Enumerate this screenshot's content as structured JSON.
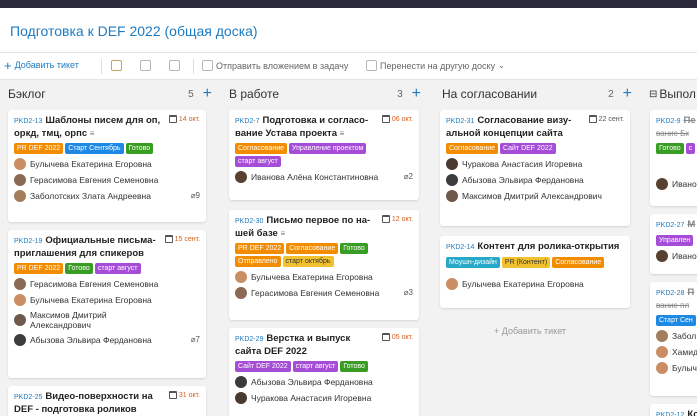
{
  "board": {
    "title": "Подготовка к DEF 2022 (общая доска)"
  },
  "toolbar": {
    "add_label": "Добавить тикет",
    "send_label": "Отправить вложением в задачу",
    "move_label": "Перенести на другую доску"
  },
  "columns": [
    {
      "title": "Бэклог",
      "count": "5",
      "plus": "+"
    },
    {
      "title": "В работе",
      "count": "3",
      "plus": "+"
    },
    {
      "title": "На согласовании",
      "count": "2",
      "plus": "+"
    },
    {
      "title": "Выпол",
      "count": "",
      "plus": ""
    }
  ],
  "colors": {
    "accent": "#1e7bc2",
    "tag_orange": "#f28c00",
    "tag_blue": "#1e88e5",
    "tag_green": "#3a9d23",
    "tag_purple": "#a64dd8",
    "tag_cyan": "#26a9c9",
    "tag_yellow": "#f2c12e"
  },
  "cards": {
    "c1": {
      "id": "PKD2-13",
      "title": "Шаблоны писем для оп, оркд, тмц, орпс",
      "date": "14 окт.",
      "tags": [
        "PR DEF 2022",
        "Старт Сентябрь",
        "Готово"
      ],
      "people": [
        "Булычева Екатерина Егоровна",
        "Герасимова Евгения Семеновна",
        "Заболотских Злата Андреевна"
      ],
      "attach": "9"
    },
    "c2": {
      "id": "PKD2-19",
      "title": "Официальные письма-приглашения для спикеров",
      "date": "15 сент.",
      "tags": [
        "PR DEF 2022",
        "Готово",
        "старт август"
      ],
      "people": [
        "Герасимова Евгения Семеновна",
        "Булычева Екатерина Егоровна",
        "Максимов Дмитрий Александрович",
        "Абызова Эльвира Ферда­новна"
      ],
      "attach": "7"
    },
    "c3": {
      "id": "PKD2-25",
      "title": "Видео-поверхности на DEF - подготовка роликов",
      "date": "31 окт."
    },
    "c4": {
      "id": "PKD2-7",
      "title": "Подготовка и согласо­вание Устава проекта",
      "date": "06 окт.",
      "tags": [
        "Согласование",
        "Управление проектом",
        "старт август"
      ],
      "people": [
        "Иванова Алёна Константиновна"
      ],
      "attach": "2"
    },
    "c5": {
      "id": "PKD2-30",
      "title": "Письмо первое по на­шей базе",
      "date": "12 окт.",
      "tags": [
        "PR DEF 2022",
        "Согласование",
        "Готово",
        "Отправлено",
        "старт октябрь"
      ],
      "people": [
        "Булычева Екатерина Егоровна",
        "Герасимова Евгения Семеновна"
      ],
      "attach": "3"
    },
    "c6": {
      "id": "PKD2-29",
      "title": "Верстка и выпуск сайта DEF 2022",
      "date": "05 окт.",
      "tags": [
        "Сайт DEF 2022",
        "старт август",
        "Готово"
      ],
      "people": [
        "Абызова Эльвира Ферда­новна",
        "Чуракова Анастасия Игоревна"
      ]
    },
    "c7": {
      "id": "PKD2-31",
      "title": "Согласование визу­альной концепции сайта",
      "date": "22 сент.",
      "tags": [
        "Согласование",
        "Сайт DEF 2022"
      ],
      "people": [
        "Чуракова Анастасия Игоревна",
        "Абызова Эльвира Ферда­новна",
        "Максимов Дмитрий Александрович"
      ]
    },
    "c8": {
      "id": "PKD2-14",
      "title": "Контент для ролика-открытия",
      "tags": [
        "Моушн-дизайн",
        "PR (Контент)",
        "Согласование"
      ],
      "people": [
        "Булычева Екатерина Егоровна"
      ]
    },
    "add_ticket": "+ Добавить тикет",
    "d1": {
      "id": "PKD2-9",
      "title": "Пе",
      "title2": "вание Бк",
      "tags": [
        "Готово",
        "с"
      ],
      "person": "Ивано"
    },
    "d2": {
      "id": "PKD2-27",
      "title": "М",
      "tags": [
        "Управлен"
      ],
      "person": "Ивано"
    },
    "d3": {
      "id": "PKD2-28",
      "title": "П",
      "title2": "вание пл",
      "tags": [
        "Старт Сен"
      ],
      "people": [
        "Забол",
        "Хамид",
        "Булыч"
      ]
    },
    "d4": {
      "id": "PKD2-12",
      "title": "Ко"
    }
  }
}
